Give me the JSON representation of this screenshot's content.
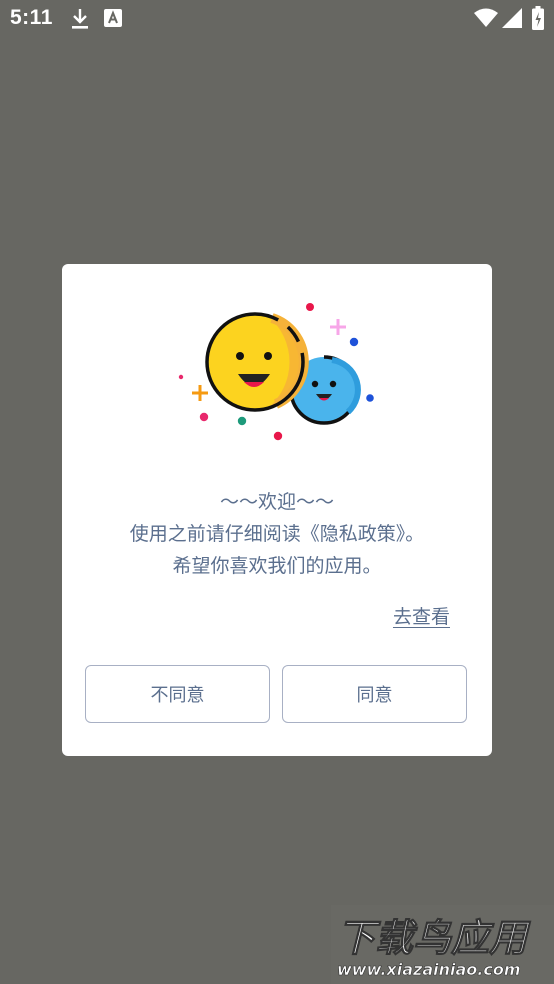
{
  "status_bar": {
    "time": "5:11",
    "icons": [
      "download-icon",
      "font-app-icon",
      "wifi-icon",
      "signal-icon",
      "battery-icon"
    ]
  },
  "dialog": {
    "welcome_line1": "～～欢迎～～",
    "welcome_line2": "使用之前请仔细阅读《隐私政策》。",
    "welcome_line3": "希望你喜欢我们的应用。",
    "view_link": "去查看",
    "disagree_button": "不同意",
    "agree_button": "同意"
  },
  "watermark": {
    "brand": "下载鸟应用",
    "url": "www.xiazainiao.com"
  },
  "colors": {
    "background": "#676762",
    "dialog": "#ffffff",
    "text": "#5b6f8e",
    "button_border": "#a8b0c4"
  }
}
